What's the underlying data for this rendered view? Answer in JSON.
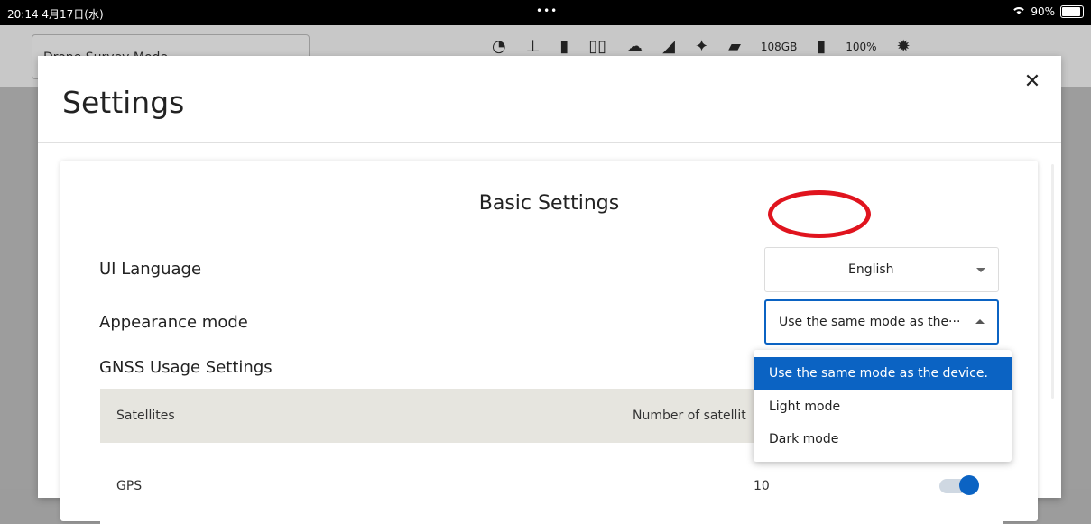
{
  "status": {
    "time": "20:14 4月17日(水)",
    "dots": "•••",
    "wifi_icon": "wifi-icon",
    "battery_pct": "90%",
    "battery_level": 0.9
  },
  "appbar": {
    "mode_label": "Drone Survey Mode",
    "storage": "108GB",
    "battery": "100%"
  },
  "modal": {
    "title": "Settings",
    "close_icon": "close-icon"
  },
  "basic": {
    "title": "Basic Settings",
    "ui_language": {
      "label": "UI Language",
      "value": "English"
    },
    "appearance": {
      "label": "Appearance mode",
      "value": "Use the same mode as the···"
    },
    "gnss_title": "GNSS Usage Settings",
    "table": {
      "headers": [
        "Satellites",
        "Number of satellit"
      ],
      "rows": [
        {
          "satellite": "GPS",
          "count": "10",
          "enabled": true
        }
      ]
    }
  },
  "dropdown": {
    "options": [
      "Use the same mode as the device.",
      "Light mode",
      "Dark mode"
    ],
    "selected": "Use the same mode as the device."
  },
  "colors": {
    "accent": "#0b63c3",
    "highlight": "#e0141e"
  }
}
